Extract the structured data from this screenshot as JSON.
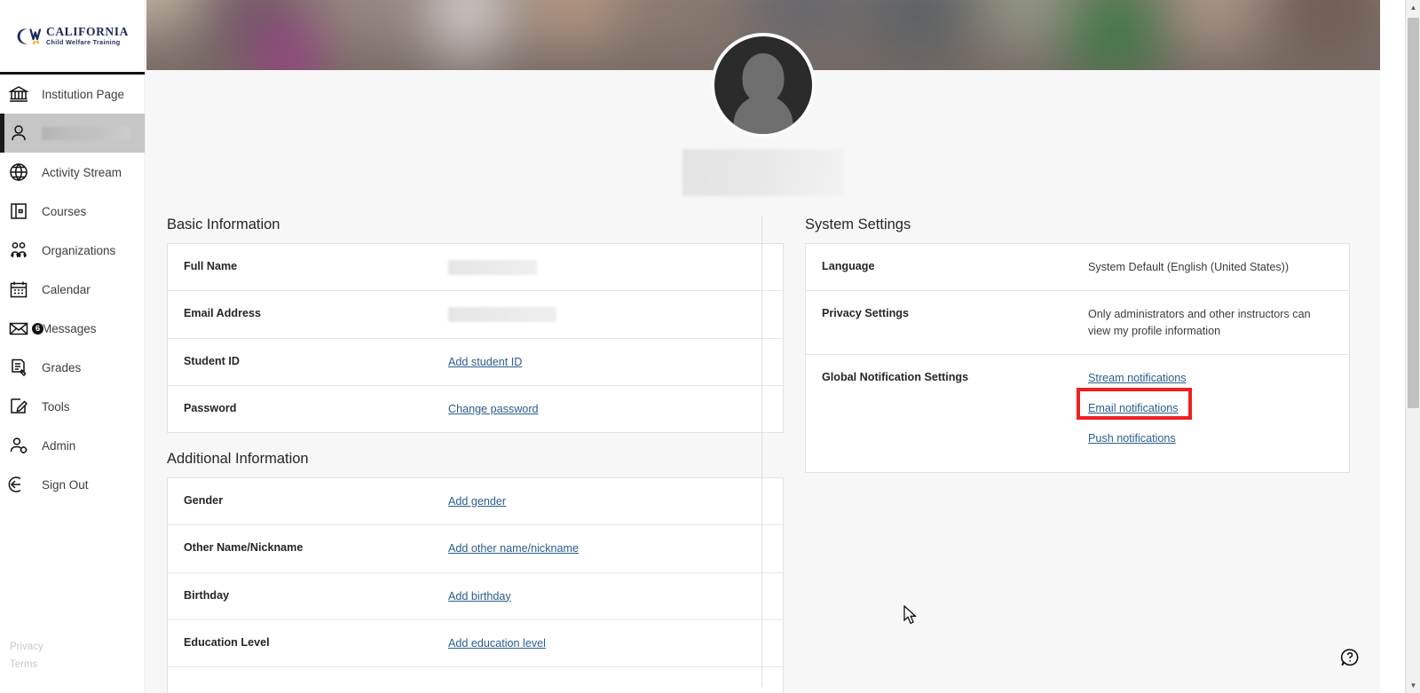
{
  "brand": {
    "title": "CALIFORNIA",
    "subtitle": "Child Welfare Training",
    "logo_icon": "cw-swoosh-logo"
  },
  "sidebar": {
    "items": [
      {
        "label": "Institution Page",
        "icon": "institution-icon",
        "active": false
      },
      {
        "label": "",
        "icon": "person-icon",
        "active": true,
        "redacted": true
      },
      {
        "label": "Activity Stream",
        "icon": "globe-icon",
        "active": false
      },
      {
        "label": "Courses",
        "icon": "book-icon",
        "active": false
      },
      {
        "label": "Organizations",
        "icon": "people-icon",
        "active": false
      },
      {
        "label": "Calendar",
        "icon": "calendar-icon",
        "active": false
      },
      {
        "label": "Messages",
        "icon": "envelope-icon",
        "active": false,
        "badge": "6"
      },
      {
        "label": "Grades",
        "icon": "grades-icon",
        "active": false
      },
      {
        "label": "Tools",
        "icon": "tools-pencil-icon",
        "active": false
      },
      {
        "label": "Admin",
        "icon": "person-gear-icon",
        "active": false
      },
      {
        "label": "Sign Out",
        "icon": "sign-out-icon",
        "active": false
      }
    ],
    "legal": [
      {
        "label": "Privacy"
      },
      {
        "label": "Terms"
      }
    ]
  },
  "profile": {
    "avatar_icon": "default-user-avatar",
    "name_redacted": true
  },
  "basic_information": {
    "title": "Basic Information",
    "rows": [
      {
        "label": "Full Name",
        "type": "redacted",
        "value": ""
      },
      {
        "label": "Email Address",
        "type": "redacted",
        "value": ""
      },
      {
        "label": "Student ID",
        "type": "link",
        "value": "Add student ID"
      },
      {
        "label": "Password",
        "type": "link",
        "value": "Change password"
      }
    ]
  },
  "additional_information": {
    "title": "Additional Information",
    "rows": [
      {
        "label": "Gender",
        "type": "link",
        "value": "Add gender"
      },
      {
        "label": "Other Name/Nickname",
        "type": "link",
        "value": "Add other name/nickname"
      },
      {
        "label": "Birthday",
        "type": "link",
        "value": "Add birthday"
      },
      {
        "label": "Education Level",
        "type": "link",
        "value": "Add education level"
      }
    ]
  },
  "system_settings": {
    "title": "System Settings",
    "language": {
      "label": "Language",
      "value": "System Default (English (United States))"
    },
    "privacy": {
      "label": "Privacy Settings",
      "value": "Only administrators and other instructors can view my profile information"
    },
    "notifications": {
      "label": "Global Notification Settings",
      "links": [
        {
          "label": "Stream notifications",
          "highlighted": false
        },
        {
          "label": "Email notifications",
          "highlighted": true
        },
        {
          "label": "Push notifications",
          "highlighted": false
        }
      ]
    }
  },
  "help": {
    "icon": "help-question-icon"
  },
  "colors": {
    "accent_link": "#2a5d8f",
    "highlight_box": "#ee2020",
    "brand_navy": "#1b2a5c",
    "brand_gold": "#e8b83a",
    "page_background": "#f7f7f7",
    "active_nav_background": "#c6c6c6"
  }
}
